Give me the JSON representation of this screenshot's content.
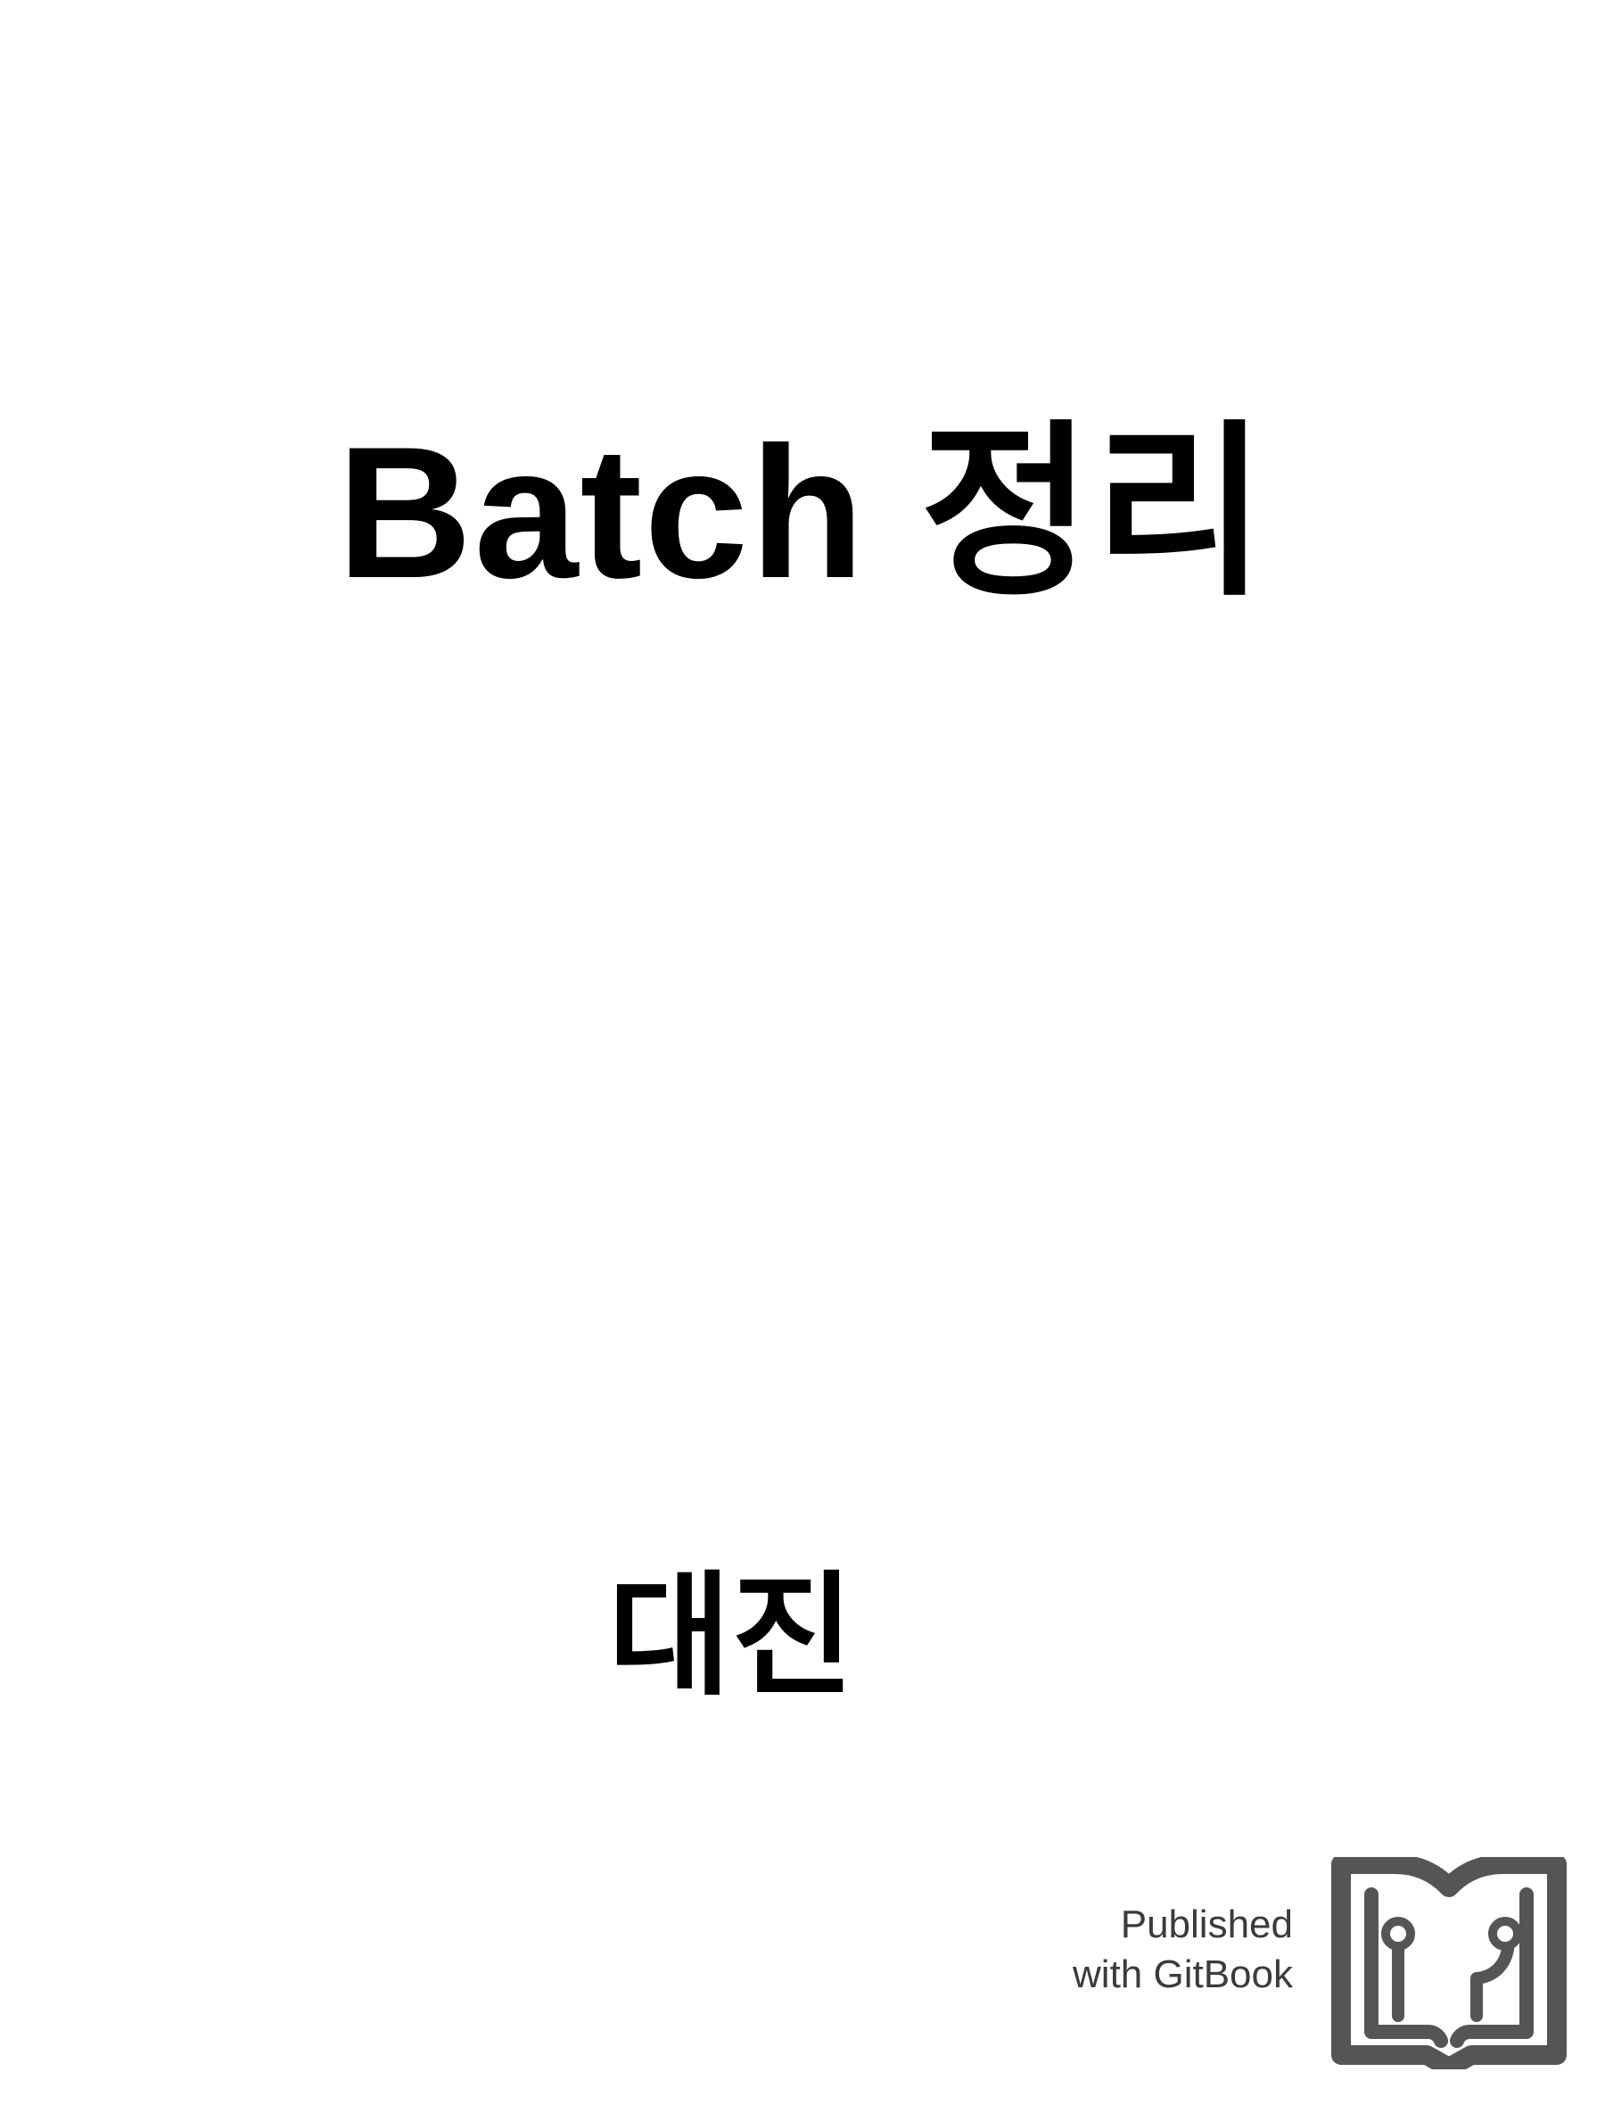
{
  "cover": {
    "title": "Batch 정리",
    "author": "대진"
  },
  "publisher": {
    "line1": "Published",
    "line2": "with GitBook",
    "logo_icon": "gitbook-logo-icon",
    "logo_color": "#555555"
  }
}
